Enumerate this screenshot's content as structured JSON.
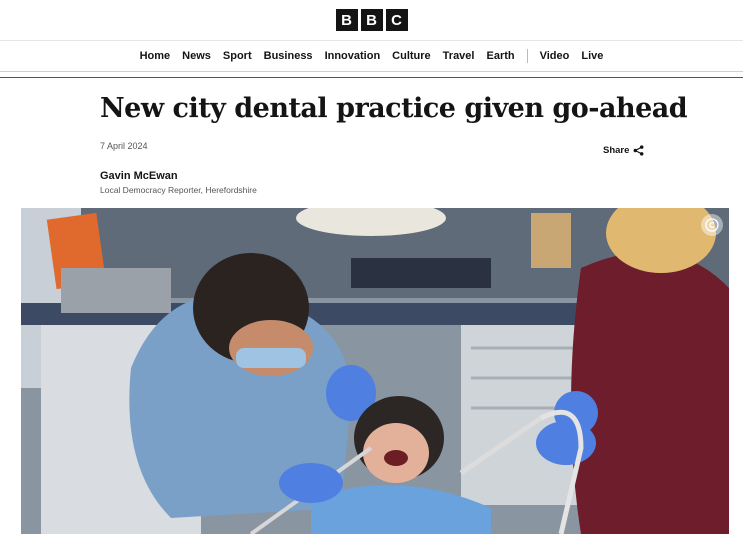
{
  "brand": {
    "letters": [
      "B",
      "B",
      "C"
    ]
  },
  "nav": {
    "items": [
      "Home",
      "News",
      "Sport",
      "Business",
      "Innovation",
      "Culture",
      "Travel",
      "Earth",
      "Video",
      "Live"
    ]
  },
  "article": {
    "headline": "New city dental practice given go-ahead",
    "date": "7 April 2024",
    "share_label": "Share",
    "author_name": "Gavin McEwan",
    "author_role": "Local Democracy Reporter, Herefordshire"
  },
  "image": {
    "subject": "dentist treating patient photo",
    "icons": {
      "share": "share-icon",
      "copyright": "copyright-icon"
    }
  }
}
